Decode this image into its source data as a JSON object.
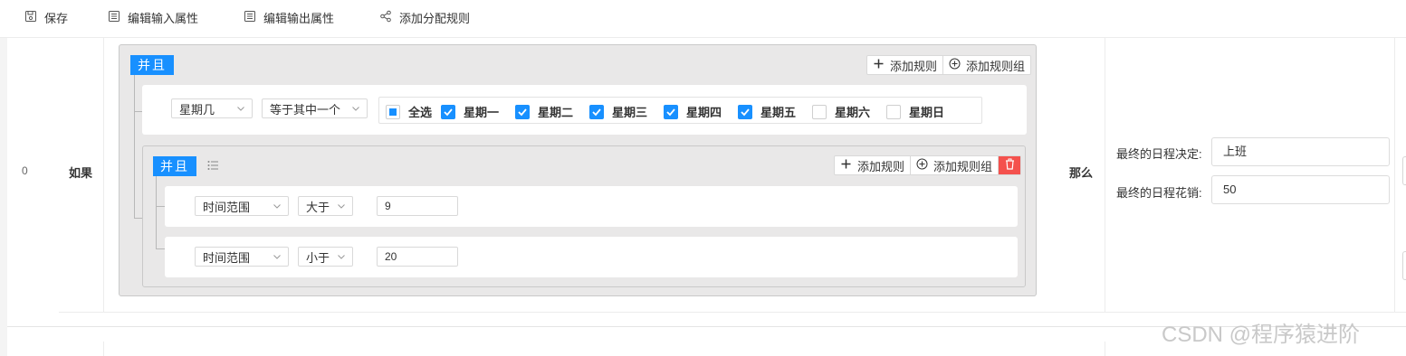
{
  "toolbar": {
    "save": "保存",
    "edit_input": "编辑输入属性",
    "edit_output": "编辑输出属性",
    "add_rule": "添加分配规则"
  },
  "row": {
    "index": "0",
    "if_label": "如果",
    "then_label": "那么"
  },
  "outer_group": {
    "logic": "并且",
    "add_rule": "添加规则",
    "add_group": "添加规则组",
    "rule": {
      "field": "星期几",
      "operator": "等于其中一个",
      "select_all": "全选",
      "options": [
        {
          "label": "星期一",
          "checked": true
        },
        {
          "label": "星期二",
          "checked": true
        },
        {
          "label": "星期三",
          "checked": true
        },
        {
          "label": "星期四",
          "checked": true
        },
        {
          "label": "星期五",
          "checked": true
        },
        {
          "label": "星期六",
          "checked": false
        },
        {
          "label": "星期日",
          "checked": false
        }
      ]
    }
  },
  "inner_group": {
    "logic": "并且",
    "add_rule": "添加规则",
    "add_group": "添加规则组",
    "rules": [
      {
        "field": "时间范围",
        "operator": "大于",
        "value": "9"
      },
      {
        "field": "时间范围",
        "operator": "小于",
        "value": "20"
      }
    ]
  },
  "result": {
    "decision_label": "最终的日程决定:",
    "decision_value": "上班",
    "cost_label": "最终的日程花销:",
    "cost_value": "50"
  },
  "watermark": "CSDN @程序猿进阶",
  "colors": {
    "primary": "#1890ff",
    "danger": "#f4514d",
    "group_bg": "#e9e8e8"
  }
}
